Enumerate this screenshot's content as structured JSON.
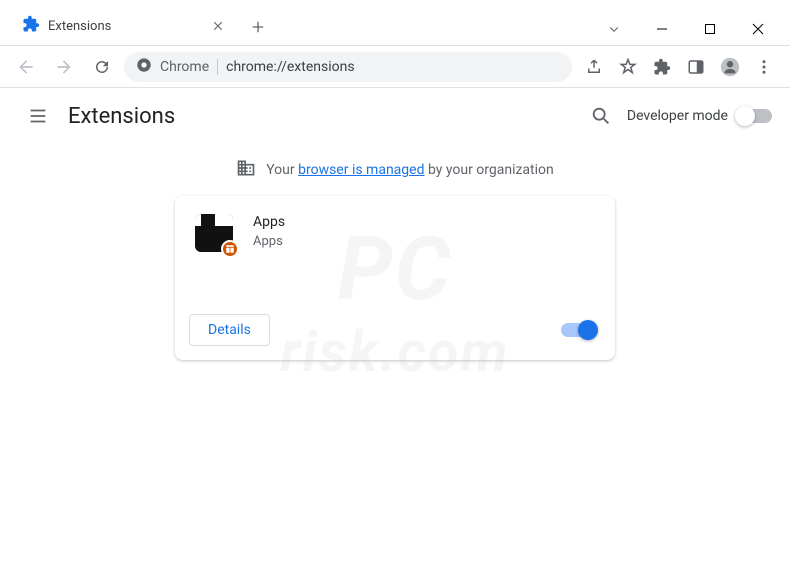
{
  "window": {
    "tab_title": "Extensions"
  },
  "omnibox": {
    "prefix": "Chrome",
    "url": "chrome://extensions"
  },
  "header": {
    "title": "Extensions",
    "dev_mode_label": "Developer mode"
  },
  "managed": {
    "pre": "Your ",
    "link": "browser is managed",
    "post": " by your organization"
  },
  "extension": {
    "name": "Apps",
    "description": "Apps",
    "details_label": "Details",
    "enabled": true
  },
  "watermark": {
    "line1": "PC",
    "line2": "risk.com"
  }
}
